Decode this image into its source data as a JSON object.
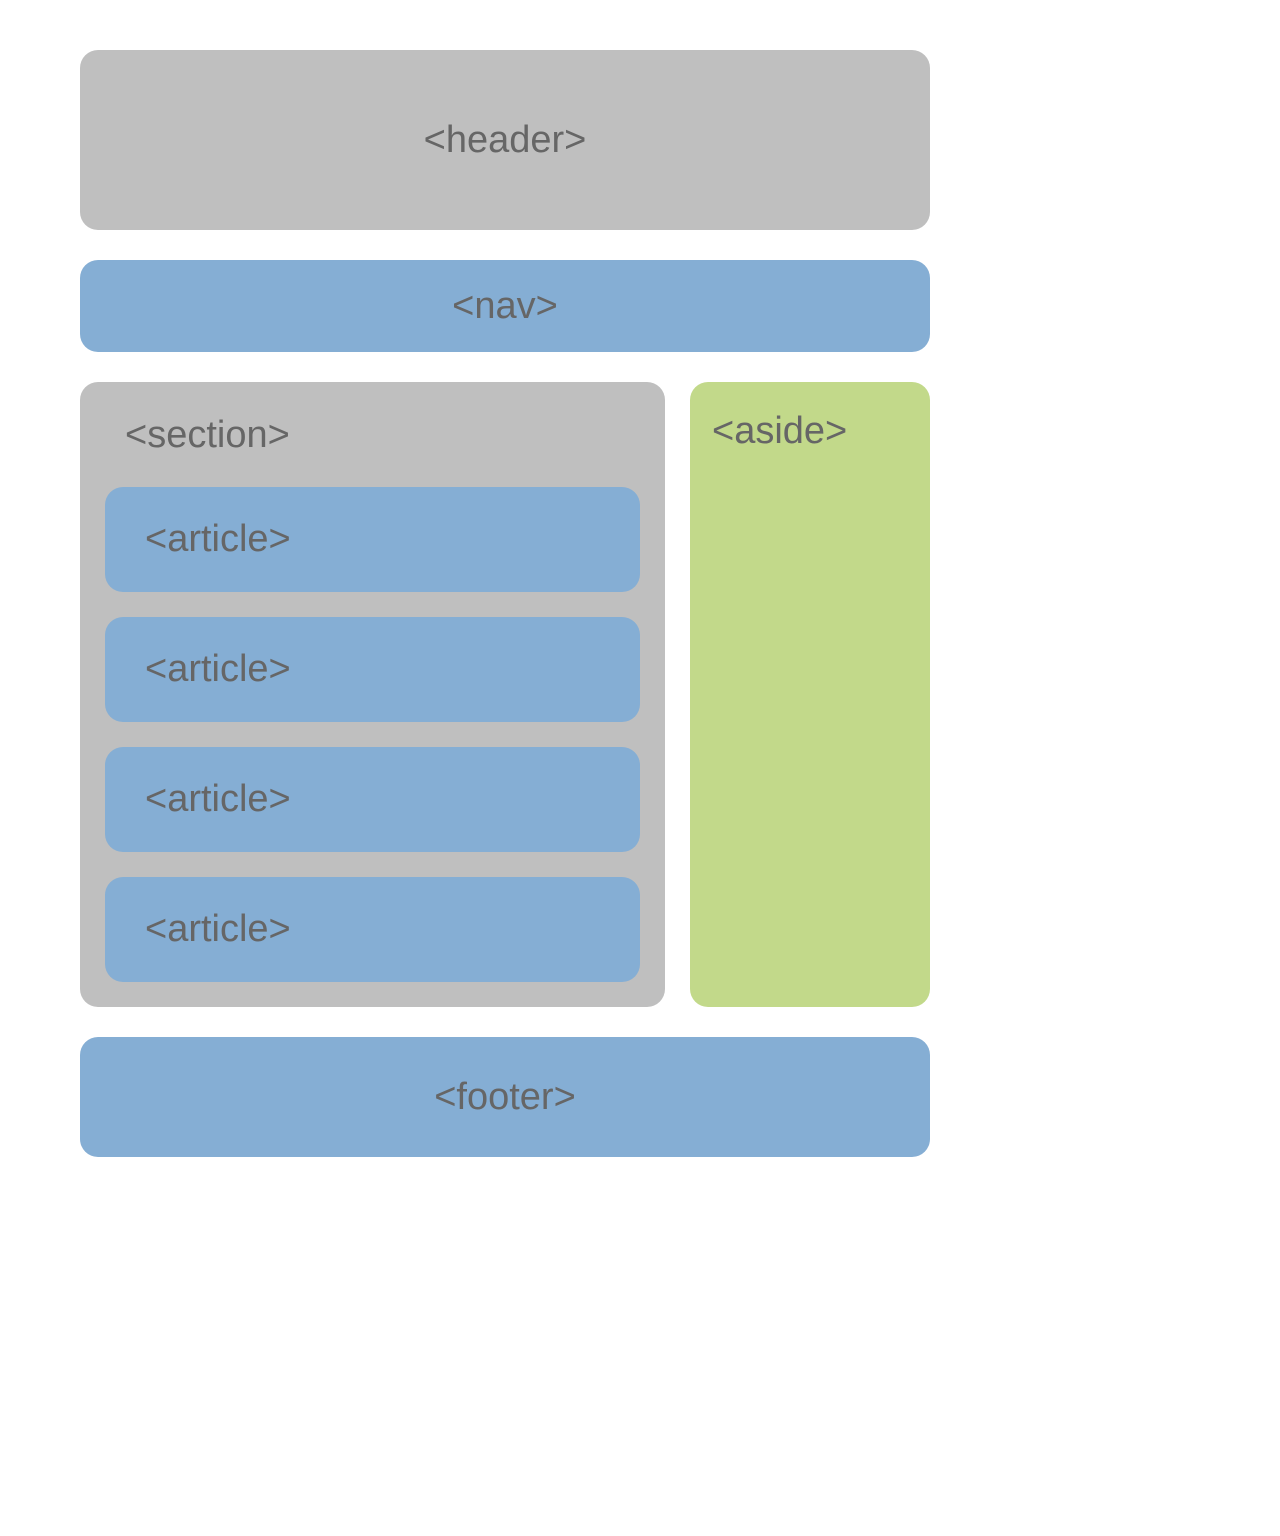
{
  "header": {
    "label": "<header>"
  },
  "nav": {
    "label": "<nav>"
  },
  "section": {
    "label": "<section>",
    "articles": [
      {
        "label": "<article>"
      },
      {
        "label": "<article>"
      },
      {
        "label": "<article>"
      },
      {
        "label": "<article>"
      }
    ]
  },
  "aside": {
    "label": "<aside>"
  },
  "footer": {
    "label": "<footer>"
  }
}
